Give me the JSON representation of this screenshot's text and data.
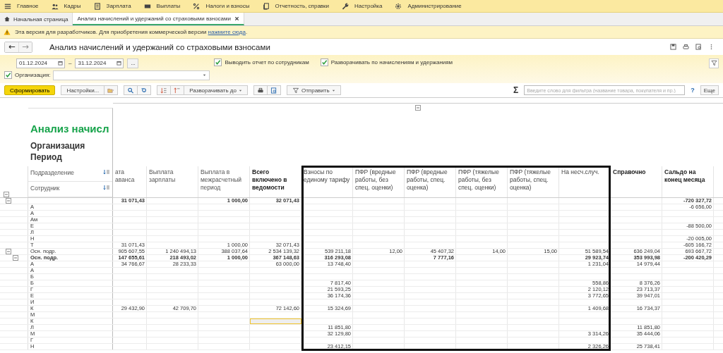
{
  "menu": [
    {
      "label": "Главное",
      "kind": "menu"
    },
    {
      "label": "Кадры",
      "kind": "people"
    },
    {
      "label": "Зарплата",
      "kind": "calculator"
    },
    {
      "label": "Выплаты",
      "kind": "card"
    },
    {
      "label": "Налоги и взносы",
      "kind": "percent"
    },
    {
      "label": "Отчетность, справки",
      "kind": "document"
    },
    {
      "label": "Настройка",
      "kind": "wrench"
    },
    {
      "label": "Администрирование",
      "kind": "gear"
    }
  ],
  "tabs": [
    {
      "label": "Начальная страница",
      "selected": false,
      "kind": "home"
    },
    {
      "label": "Анализ начислений и удержаний со страховыми взносами",
      "selected": true,
      "kind": "report"
    }
  ],
  "notice": {
    "text": "Эта версия для разработчиков. Для приобретения коммерческой версии",
    "link": "нажмите сюда",
    "tail": "."
  },
  "title": "Анализ начислений и удержаний со страховыми взносами",
  "period": {
    "from": "01.12.2024",
    "separator": "–",
    "to": "31.12.2024",
    "more": "..."
  },
  "options": [
    {
      "label": "Выводить отчет по сотрудникам",
      "checked": true
    },
    {
      "label": "Разворачивать по начислениям и удержаниям",
      "checked": true
    }
  ],
  "organization": {
    "label": "Организация:",
    "checked": true
  },
  "toolbar": {
    "generate": "Сформировать",
    "settings": "Настройки...",
    "expand": "Разворачивать до",
    "send": "Отправить",
    "sum": "Σ",
    "search_placeholder": "Введите слово для фильтра (название товара, покупателя и пр.)",
    "help": "?",
    "more": "Еще"
  },
  "report": {
    "title": "Анализ начисл",
    "header_lines": [
      "Организация",
      "Период"
    ],
    "group_columns": [
      "Подразделение",
      "Сотрудник"
    ],
    "columns": [
      {
        "label": "ата аванса",
        "bold": false,
        "framed": false
      },
      {
        "label": "Выплата зарплаты",
        "bold": false,
        "framed": false
      },
      {
        "label": "Выплата в межрасчетный период",
        "bold": false,
        "framed": false
      },
      {
        "label": "Всего включено в ведомости",
        "bold": true,
        "framed": false
      },
      {
        "label": "Взносы по единому тарифу",
        "bold": false,
        "framed": true
      },
      {
        "label": "ПФР (вредные работы, без спец. оценки)",
        "bold": false,
        "framed": true
      },
      {
        "label": "ПФР (вредные работы, спец. оценка)",
        "bold": false,
        "framed": true
      },
      {
        "label": "ПФР (тяжелые работы, без спец. оценки)",
        "bold": false,
        "framed": true
      },
      {
        "label": "ПФР (тяжелые работы, спец. оценка)",
        "bold": false,
        "framed": true
      },
      {
        "label": "На несч.случ.",
        "bold": false,
        "framed": true
      },
      {
        "label": "Справочно",
        "bold": true,
        "framed": false
      },
      {
        "label": "Сальдо на конец месяца",
        "bold": true,
        "framed": false
      }
    ],
    "rows": [
      {
        "bold": true,
        "values": {
          "advance": "31 071,43",
          "interim": "1 000,00",
          "total": "32 071,43",
          "balance": "-720 327,72"
        },
        "children": [
          {
            "name": "А",
            "bold": false,
            "values": {
              "balance": "-6 656,00"
            }
          },
          {
            "name": "А",
            "bold": false
          },
          {
            "name": "Ам",
            "bold": false
          },
          {
            "name": "Е",
            "bold": false,
            "values": {
              "balance": "-88 500,00"
            }
          },
          {
            "name": "Л",
            "bold": false
          },
          {
            "name": "Н",
            "bold": false,
            "values": {
              "balance": "-20 005,00"
            }
          },
          {
            "name": "Т",
            "bold": false,
            "values": {
              "advance": "31 071,43",
              "interim": "1 000,00",
              "total": "32 071,43",
              "balance": "-605 166,72"
            }
          }
        ]
      },
      {
        "name": "Осн. подр.",
        "bold": false,
        "values": {
          "advance": "905 607,55",
          "salary": "1 240 494,13",
          "interim": "388 037,64",
          "total": "2 534 139,32",
          "unified": "539 211,18",
          "harmful_plain": "12,00",
          "harmful_assessed": "45 407,32",
          "hard_plain": "14,00",
          "hard_assessed": "15,00",
          "accident": "51 589,54",
          "reference": "636 249,04",
          "balance": "693 667,72"
        },
        "children": [
          {
            "name": "Осн. подр.",
            "bold": true,
            "values": {
              "advance": "147 655,61",
              "salary": "218 493,02",
              "interim": "1 000,00",
              "total": "367 148,63",
              "unified": "316 293,08",
              "harmful_assessed": "7 777,16",
              "accident": "29 923,74",
              "reference": "353 993,98",
              "balance": "-200 420,29"
            },
            "children": [
              {
                "name": "А",
                "bold": false,
                "values": {
                  "advance": "34 766,67",
                  "salary": "28 233,33",
                  "total": "63 000,00",
                  "unified": "13 748,40",
                  "accident": "1 231,04",
                  "reference": "14 979,44"
                }
              },
              {
                "name": "А",
                "bold": false
              },
              {
                "name": "Б",
                "bold": false
              },
              {
                "name": "Б",
                "bold": false,
                "values": {
                  "unified": "7 817,40",
                  "accident": "558,86",
                  "reference": "8 376,26"
                }
              },
              {
                "name": "Г",
                "bold": false,
                "values": {
                  "unified": "21 593,25",
                  "accident": "2 120,12",
                  "reference": "23 713,37"
                }
              },
              {
                "name": "Е",
                "bold": false,
                "values": {
                  "unified": "36 174,36",
                  "accident": "3 772,65",
                  "reference": "39 947,01"
                }
              },
              {
                "name": "И",
                "bold": false
              },
              {
                "name": "К",
                "bold": false,
                "values": {
                  "advance": "29 432,90",
                  "salary": "42 709,70",
                  "total": "72 142,60",
                  "unified": "15 324,69",
                  "accident": "1 409,68",
                  "reference": "16 734,37"
                }
              },
              {
                "name": "М",
                "bold": false
              },
              {
                "name": "К",
                "bold": false,
                "values": {
                  "total": {
                    "selected": true
                  }
                }
              },
              {
                "name": "Л",
                "bold": false,
                "values": {
                  "unified": "11 851,80",
                  "reference": "11 851,80"
                }
              },
              {
                "name": "М",
                "bold": false,
                "values": {
                  "unified": "32 129,80",
                  "accident": "3 314,26",
                  "reference": "35 444,06"
                }
              },
              {
                "name": "Г",
                "bold": false
              },
              {
                "name": "Н",
                "bold": false,
                "values": {
                  "unified": "23 412,15",
                  "accident": "2 326,26",
                  "reference": "25 738,41"
                }
              }
            ]
          }
        ]
      }
    ]
  }
}
